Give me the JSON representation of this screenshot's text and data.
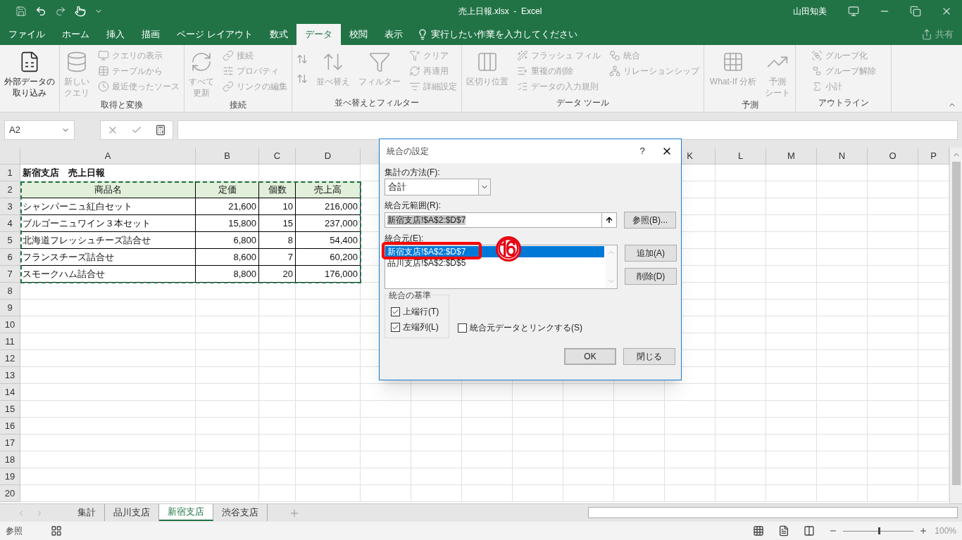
{
  "title_bar": {
    "title": "売上日報.xlsx  -  Excel",
    "user": "山田知美"
  },
  "menu_tabs": [
    {
      "label": "ファイル",
      "selected": false
    },
    {
      "label": "ホーム",
      "selected": false
    },
    {
      "label": "挿入",
      "selected": false
    },
    {
      "label": "描画",
      "selected": false
    },
    {
      "label": "ページ レイアウト",
      "selected": false
    },
    {
      "label": "数式",
      "selected": false
    },
    {
      "label": "データ",
      "selected": true
    },
    {
      "label": "校閲",
      "selected": false
    },
    {
      "label": "表示",
      "selected": false
    }
  ],
  "tell_me": "実行したい作業を入力してください",
  "share": "共有",
  "ribbon": [
    {
      "buttons": [
        {
          "kind": "tall",
          "lines": [
            "外部データの",
            "取り込み"
          ],
          "disabled": false
        }
      ]
    },
    {
      "label": "取得と変換",
      "buttons": [
        {
          "kind": "tall",
          "lines": [
            "新しい",
            "クエリ"
          ],
          "disabled": true
        },
        {
          "kind": "small",
          "label": "クエリの表示",
          "disabled": true
        },
        {
          "kind": "small",
          "label": "テーブルから",
          "disabled": true
        },
        {
          "kind": "small",
          "label": "最近使ったソース",
          "disabled": true
        }
      ]
    },
    {
      "label": "接続",
      "buttons": [
        {
          "kind": "tall",
          "lines": [
            "すべて",
            "更新"
          ],
          "disabled": true
        },
        {
          "kind": "small",
          "label": "接続",
          "disabled": true
        },
        {
          "kind": "small",
          "label": "プロパティ",
          "disabled": true
        },
        {
          "kind": "small",
          "label": "リンクの編集",
          "disabled": true
        }
      ]
    },
    {
      "label": "並べ替えとフィルター",
      "buttons": [
        {
          "kind": "sort",
          "disabled": true
        },
        {
          "kind": "large",
          "label": "並べ替え",
          "disabled": true
        },
        {
          "kind": "large",
          "label": "フィルター",
          "disabled": true
        },
        {
          "kind": "small",
          "label": "クリア",
          "disabled": true
        },
        {
          "kind": "small",
          "label": "再適用",
          "disabled": true
        },
        {
          "kind": "small",
          "label": "詳細設定",
          "disabled": true
        }
      ]
    },
    {
      "label": "データ ツール",
      "buttons": [
        {
          "kind": "large",
          "label": "区切り位置",
          "disabled": true
        },
        {
          "kind": "small",
          "label": "フラッシュ フィル",
          "disabled": true
        },
        {
          "kind": "small",
          "label": "重複の削除",
          "disabled": true
        },
        {
          "kind": "small",
          "label": "データの入力規則",
          "disabled": true
        },
        {
          "kind": "small",
          "label": "統合",
          "disabled": true
        },
        {
          "kind": "small",
          "label": "リレーションシップ",
          "disabled": true
        }
      ]
    },
    {
      "label": "予測",
      "buttons": [
        {
          "kind": "large",
          "label": "What-If 分析",
          "disabled": true
        },
        {
          "kind": "tall",
          "lines": [
            "予測",
            "シート"
          ],
          "disabled": true
        }
      ]
    },
    {
      "label": "アウトライン",
      "buttons": [
        {
          "kind": "small",
          "label": "グループ化",
          "disabled": true
        },
        {
          "kind": "small",
          "label": "グループ解除",
          "disabled": true
        },
        {
          "kind": "small",
          "label": "小計",
          "disabled": true
        }
      ]
    }
  ],
  "formula_bar": {
    "name_box": "A2"
  },
  "columns_left": [
    "A",
    "B",
    "C",
    "D"
  ],
  "columns_right": [
    "K",
    "L",
    "M",
    "N",
    "O",
    "P"
  ],
  "rows": [
    {
      "number": "1",
      "kind": "title",
      "cells": [
        "新宿支店　売上日報"
      ]
    },
    {
      "number": "2",
      "kind": "header",
      "cells": [
        "商品名",
        "定価",
        "個数",
        "売上高"
      ]
    },
    {
      "number": "3",
      "kind": "data",
      "cells": [
        "シャンパーニュ紅白セット",
        "21,600",
        "10",
        "216,000"
      ]
    },
    {
      "number": "4",
      "kind": "data",
      "cells": [
        "ブルゴーニュワイン３本セット",
        "15,800",
        "15",
        "237,000"
      ]
    },
    {
      "number": "5",
      "kind": "data",
      "cells": [
        "北海道フレッシュチーズ詰合せ",
        "6,800",
        "8",
        "54,400"
      ]
    },
    {
      "number": "6",
      "kind": "data",
      "cells": [
        "フランスチーズ詰合せ",
        "8,600",
        "7",
        "60,200"
      ]
    },
    {
      "number": "7",
      "kind": "data",
      "cells": [
        "スモークハム詰合せ",
        "8,800",
        "20",
        "176,000"
      ]
    },
    {
      "number": "8"
    },
    {
      "number": "9"
    },
    {
      "number": "10"
    },
    {
      "number": "11"
    },
    {
      "number": "12"
    },
    {
      "number": "13"
    },
    {
      "number": "14"
    },
    {
      "number": "15"
    },
    {
      "number": "16"
    },
    {
      "number": "17"
    },
    {
      "number": "18"
    },
    {
      "number": "19"
    },
    {
      "number": "20"
    }
  ],
  "sheet_tabs": [
    {
      "label": "集計",
      "selected": false
    },
    {
      "label": "品川支店",
      "selected": false
    },
    {
      "label": "新宿支店",
      "selected": true
    },
    {
      "label": "渋谷支店",
      "selected": false
    }
  ],
  "status_bar": {
    "mode": "参照",
    "zoom": "100%",
    "zoom_slider": {
      "level": 0.5
    }
  },
  "dialog": {
    "title": "統合の設定",
    "help": "?",
    "function_label": "集計の方法(F):",
    "function_value": "合計",
    "reference_label": "統合元範囲(R):",
    "reference_value": "新宿支店!$A$2:$D$7",
    "browse": "参照(B)...",
    "references_label": "統合元(E):",
    "references": [
      {
        "text": "新宿支店!$A$2:$D$7",
        "selected": true
      },
      {
        "text": "品川支店!$A$2:$D$5",
        "selected": false
      }
    ],
    "add": "追加(A)",
    "delete": "削除(D)",
    "labels_group": "統合の基準",
    "checkboxes": [
      {
        "label": "上端行(T)",
        "checked": true
      },
      {
        "label": "左端列(L)",
        "checked": true
      },
      {
        "label": "統合元データとリンクする(S)",
        "checked": false
      }
    ],
    "ok": "OK",
    "close": "閉じる"
  },
  "callout": {
    "text": "⑯"
  }
}
